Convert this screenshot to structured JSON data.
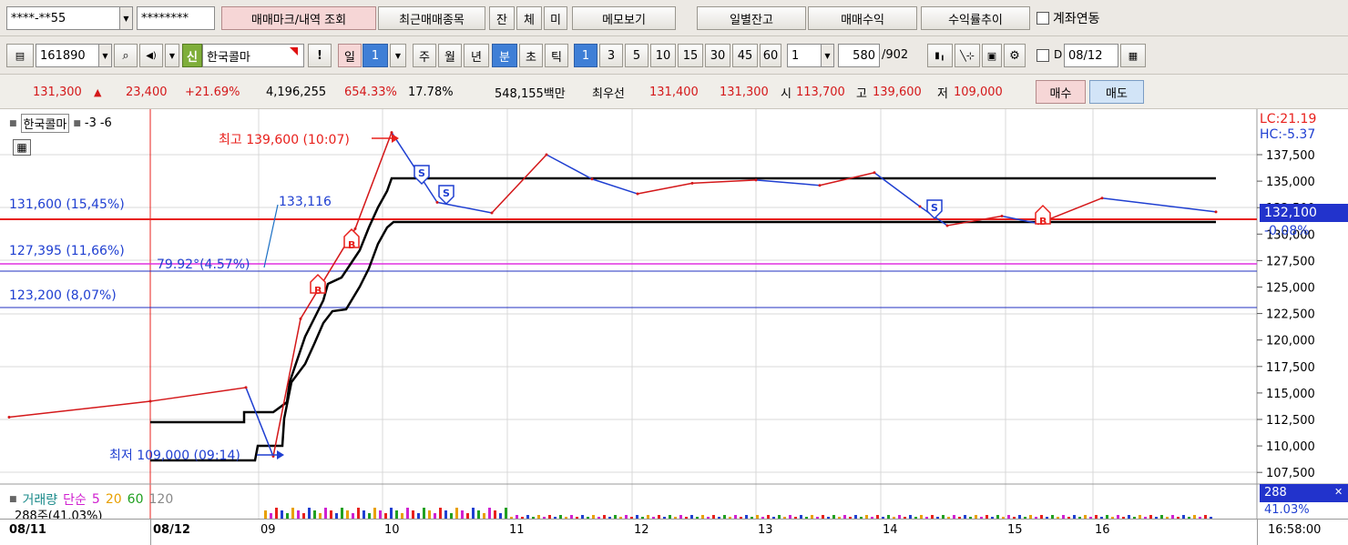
{
  "toolbar1": {
    "account_no": "****-**55",
    "password": "********",
    "trade_mark_btn": "매매마크/내역 조회",
    "recent_btn": "최근매매종목",
    "tab_jan": "잔",
    "tab_che": "체",
    "tab_mi": "미",
    "memo_btn": "메모보기",
    "daily_balance_btn": "일별잔고",
    "trade_profit_btn": "매매수익",
    "return_trend_btn": "수익률추이",
    "account_link_label": "계좌연동"
  },
  "toolbar2": {
    "code": "161890",
    "badge": "신",
    "stock_name": "한국콜마",
    "alert": "!",
    "period_day": "일",
    "period_n": "1",
    "periods": [
      "주",
      "월",
      "년"
    ],
    "minute": "분",
    "second": "초",
    "tick": "틱",
    "intervals": [
      "1",
      "3",
      "5",
      "10",
      "15",
      "30",
      "45",
      "60"
    ],
    "interval_value": "1",
    "count_value": "580",
    "count_total": "/902",
    "d_label": "D",
    "date_value": "08/12"
  },
  "quote": {
    "price": "131,300",
    "arrow": "▲",
    "change": "23,400",
    "change_pct": "+21.69%",
    "volume": "4,196,255",
    "vol_ratio": "654.33%",
    "turnover": "17.78%",
    "amount": "548,155백만",
    "best_label": "최우선",
    "ask": "131,400",
    "bid": "131,300",
    "open_label": "시",
    "open": "113,700",
    "high_label": "고",
    "high": "139,600",
    "low_label": "저",
    "low": "109,000",
    "buy_btn": "매수",
    "sell_btn": "매도"
  },
  "chart": {
    "legend_name": "한국콜마",
    "legend_extra1": "-3",
    "legend_extra2": "-6",
    "high_annot": "최고 139,600 (10:07)",
    "low_annot": "최저 109,000 (09:14)",
    "level_top": "131,600 (15,45%)",
    "level_mid": "127,395 (11,66%)",
    "level_low": "123,200 (8,07%)",
    "trend_value": "133,116",
    "angle_label": "79.92°(4.57%)",
    "lc_label": "LC:21.19",
    "hc_label": "HC:-5.37",
    "current_price_tag": "132,100",
    "current_pct": "-0.08%",
    "y_ticks": [
      "137,500",
      "135,000",
      "132,500",
      "130,000",
      "127,500",
      "125,000",
      "122,500",
      "120,000",
      "117,500",
      "115,000",
      "112,500",
      "110,000",
      "107,500"
    ],
    "volume_legend": "거래량",
    "ma_legend": "단순",
    "ma_periods": [
      "5",
      "20",
      "60",
      "120"
    ],
    "volume_sub": "288주(41.03%)",
    "vol_tag": "288",
    "vol_pct": "41.03%",
    "x_labels": [
      "08/11",
      "08/12",
      "09",
      "10",
      "11",
      "12",
      "13",
      "14",
      "15",
      "16"
    ],
    "time_label": "16:58:00",
    "colors": {
      "price_up": "#d4181a",
      "price_down": "#1f3fd1",
      "bands": "#000000",
      "level_line": "#e8201c",
      "pink_line": "#e030e0"
    }
  },
  "chart_data": {
    "type": "line",
    "title": "",
    "x": [
      "08/11",
      "08/12 09:00",
      "09:10",
      "09:14",
      "09:30",
      "09:50",
      "10:07",
      "10:30",
      "11:00",
      "11:20",
      "11:40",
      "12:00",
      "12:30",
      "13:00",
      "13:30",
      "13:50",
      "14:10",
      "14:30",
      "15:00",
      "15:20",
      "15:40",
      "16:00"
    ],
    "series": [
      {
        "values": [
          112700,
          114200,
          115500,
          109000,
          122000,
          130500,
          139600,
          133000,
          132000,
          137500,
          135200,
          133800,
          134800,
          135100,
          134600,
          135800,
          132600,
          130800,
          131700,
          131000,
          133400,
          132100
        ]
      }
    ],
    "ylim": [
      107000,
      139600
    ],
    "annotations": {
      "high": 139600,
      "low": 109000
    }
  }
}
